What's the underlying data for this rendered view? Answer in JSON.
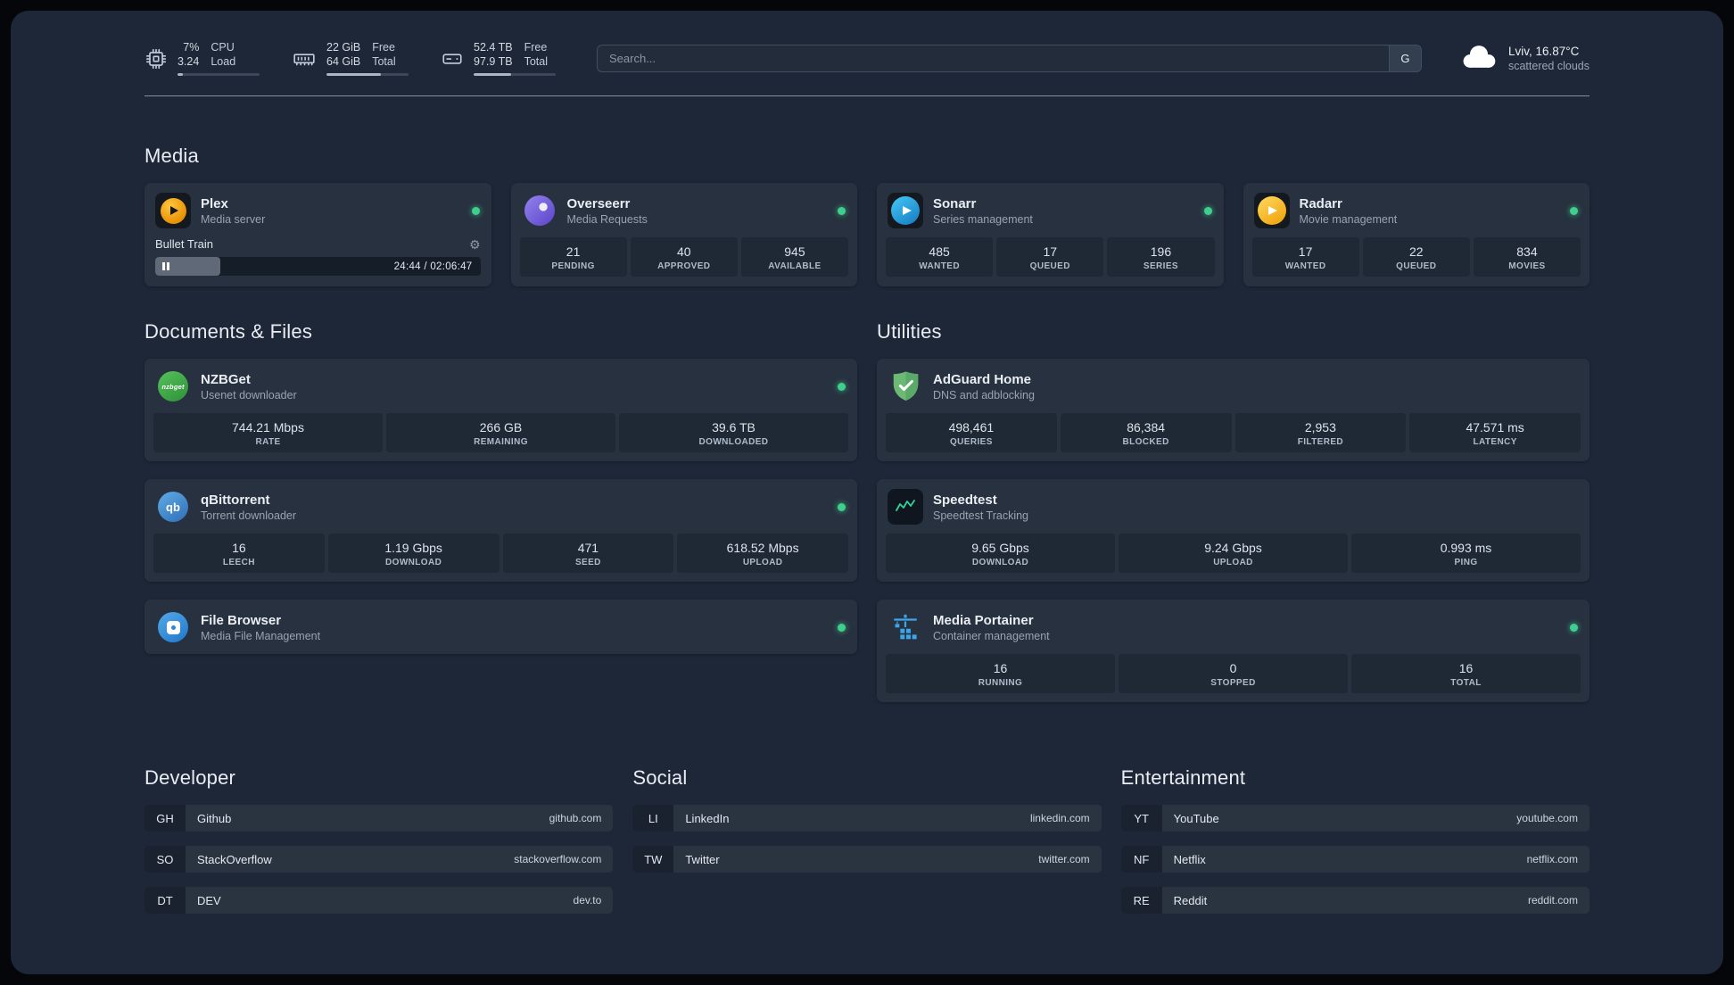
{
  "colors": {
    "background": "#1e2737",
    "card": "#27313f",
    "stat_block": "#1f2835",
    "status_online": "#3ecf8e",
    "plex_orange": "#eba310",
    "overseerr_purple": "#6d59cf",
    "sonarr_blue": "#2193d3",
    "radarr_gold": "#f0a90a",
    "nzbget_green": "#43a84c",
    "qbittorrent_blue": "#4b95d4",
    "filebrowser_blue": "#2f86d8",
    "adguard_green": "#66b574",
    "speedtest_green": "#34d399",
    "portainer_blue": "#3ca6e8"
  },
  "header": {
    "cpu": {
      "values": [
        "7%",
        "3.24"
      ],
      "labels": [
        "CPU",
        "Load"
      ],
      "progress": "7%"
    },
    "memory": {
      "values": [
        "22 GiB",
        "64 GiB"
      ],
      "labels": [
        "Free",
        "Total"
      ],
      "progress": "66%"
    },
    "disk": {
      "values": [
        "52.4 TB",
        "97.9 TB"
      ],
      "labels": [
        "Free",
        "Total"
      ],
      "progress": "46%"
    },
    "search": {
      "placeholder": "Search...",
      "provider_label": "G"
    },
    "weather": {
      "location": "Lviv, 16.87°C",
      "condition": "scattered clouds"
    }
  },
  "section_titles": {
    "media": "Media",
    "documents": "Documents & Files",
    "utilities": "Utilities",
    "developer": "Developer",
    "social": "Social",
    "entertainment": "Entertainment"
  },
  "services": {
    "plex": {
      "name": "Plex",
      "desc": "Media server",
      "now_playing": {
        "title": "Bullet Train",
        "time": "24:44 / 02:06:47",
        "progress": "20%"
      }
    },
    "overseerr": {
      "name": "Overseerr",
      "desc": "Media Requests",
      "stats": [
        {
          "value": "21",
          "label": "PENDING"
        },
        {
          "value": "40",
          "label": "APPROVED"
        },
        {
          "value": "945",
          "label": "AVAILABLE"
        }
      ]
    },
    "sonarr": {
      "name": "Sonarr",
      "desc": "Series management",
      "stats": [
        {
          "value": "485",
          "label": "WANTED"
        },
        {
          "value": "17",
          "label": "QUEUED"
        },
        {
          "value": "196",
          "label": "SERIES"
        }
      ]
    },
    "radarr": {
      "name": "Radarr",
      "desc": "Movie management",
      "stats": [
        {
          "value": "17",
          "label": "WANTED"
        },
        {
          "value": "22",
          "label": "QUEUED"
        },
        {
          "value": "834",
          "label": "MOVIES"
        }
      ]
    },
    "nzbget": {
      "name": "NZBGet",
      "desc": "Usenet downloader",
      "icon_text": "nzbget",
      "stats": [
        {
          "value": "744.21 Mbps",
          "label": "RATE"
        },
        {
          "value": "266 GB",
          "label": "REMAINING"
        },
        {
          "value": "39.6 TB",
          "label": "DOWNLOADED"
        }
      ]
    },
    "qbittorrent": {
      "name": "qBittorrent",
      "desc": "Torrent downloader",
      "icon_text": "qb",
      "stats": [
        {
          "value": "16",
          "label": "LEECH"
        },
        {
          "value": "1.19 Gbps",
          "label": "DOWNLOAD"
        },
        {
          "value": "471",
          "label": "SEED"
        },
        {
          "value": "618.52 Mbps",
          "label": "UPLOAD"
        }
      ]
    },
    "filebrowser": {
      "name": "File Browser",
      "desc": "Media File Management"
    },
    "adguard": {
      "name": "AdGuard Home",
      "desc": "DNS and adblocking",
      "stats": [
        {
          "value": "498,461",
          "label": "QUERIES"
        },
        {
          "value": "86,384",
          "label": "BLOCKED"
        },
        {
          "value": "2,953",
          "label": "FILTERED"
        },
        {
          "value": "47.571 ms",
          "label": "LATENCY"
        }
      ]
    },
    "speedtest": {
      "name": "Speedtest",
      "desc": "Speedtest Tracking",
      "stats": [
        {
          "value": "9.65 Gbps",
          "label": "DOWNLOAD"
        },
        {
          "value": "9.24 Gbps",
          "label": "UPLOAD"
        },
        {
          "value": "0.993 ms",
          "label": "PING"
        }
      ]
    },
    "portainer": {
      "name": "Media Portainer",
      "desc": "Container management",
      "stats": [
        {
          "value": "16",
          "label": "RUNNING"
        },
        {
          "value": "0",
          "label": "STOPPED"
        },
        {
          "value": "16",
          "label": "TOTAL"
        }
      ]
    }
  },
  "bookmarks": {
    "developer": [
      {
        "abbr": "GH",
        "name": "Github",
        "domain": "github.com"
      },
      {
        "abbr": "SO",
        "name": "StackOverflow",
        "domain": "stackoverflow.com"
      },
      {
        "abbr": "DT",
        "name": "DEV",
        "domain": "dev.to"
      }
    ],
    "social": [
      {
        "abbr": "LI",
        "name": "LinkedIn",
        "domain": "linkedin.com"
      },
      {
        "abbr": "TW",
        "name": "Twitter",
        "domain": "twitter.com"
      }
    ],
    "entertainment": [
      {
        "abbr": "YT",
        "name": "YouTube",
        "domain": "youtube.com"
      },
      {
        "abbr": "NF",
        "name": "Netflix",
        "domain": "netflix.com"
      },
      {
        "abbr": "RE",
        "name": "Reddit",
        "domain": "reddit.com"
      }
    ]
  }
}
